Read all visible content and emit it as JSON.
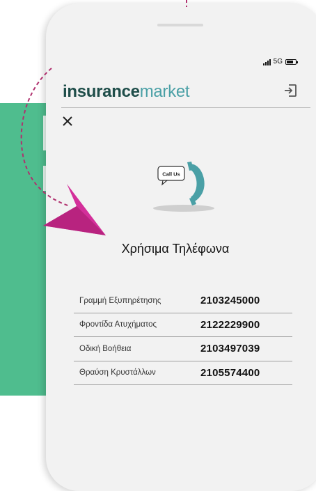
{
  "status_bar": {
    "network": "5G"
  },
  "header": {
    "brand_bold": "insurance",
    "brand_light": "market"
  },
  "illustration": {
    "bubble_text": "Call Us"
  },
  "page": {
    "title": "Χρήσιμα Τηλέφωνα"
  },
  "contacts": [
    {
      "label": "Γραμμή Εξυπηρέτησης",
      "number": "2103245000"
    },
    {
      "label": "Φροντίδα Ατυχήματος",
      "number": "2122229900"
    },
    {
      "label": "Οδική Βοήθεια",
      "number": "2103497039"
    },
    {
      "label": "Θραύση Κρυστάλλων",
      "number": "2105574400"
    }
  ],
  "colors": {
    "green_panel": "#4fbd8e",
    "arrow_magenta": "#d32f9a",
    "brand_dark": "#1f4e4a",
    "brand_teal": "#4aa0a6",
    "dashed_line": "#b0306e"
  },
  "icons": [
    "signal-icon",
    "battery-icon",
    "logout-icon",
    "close-icon",
    "phone-handset-icon",
    "arrow-icon"
  ]
}
